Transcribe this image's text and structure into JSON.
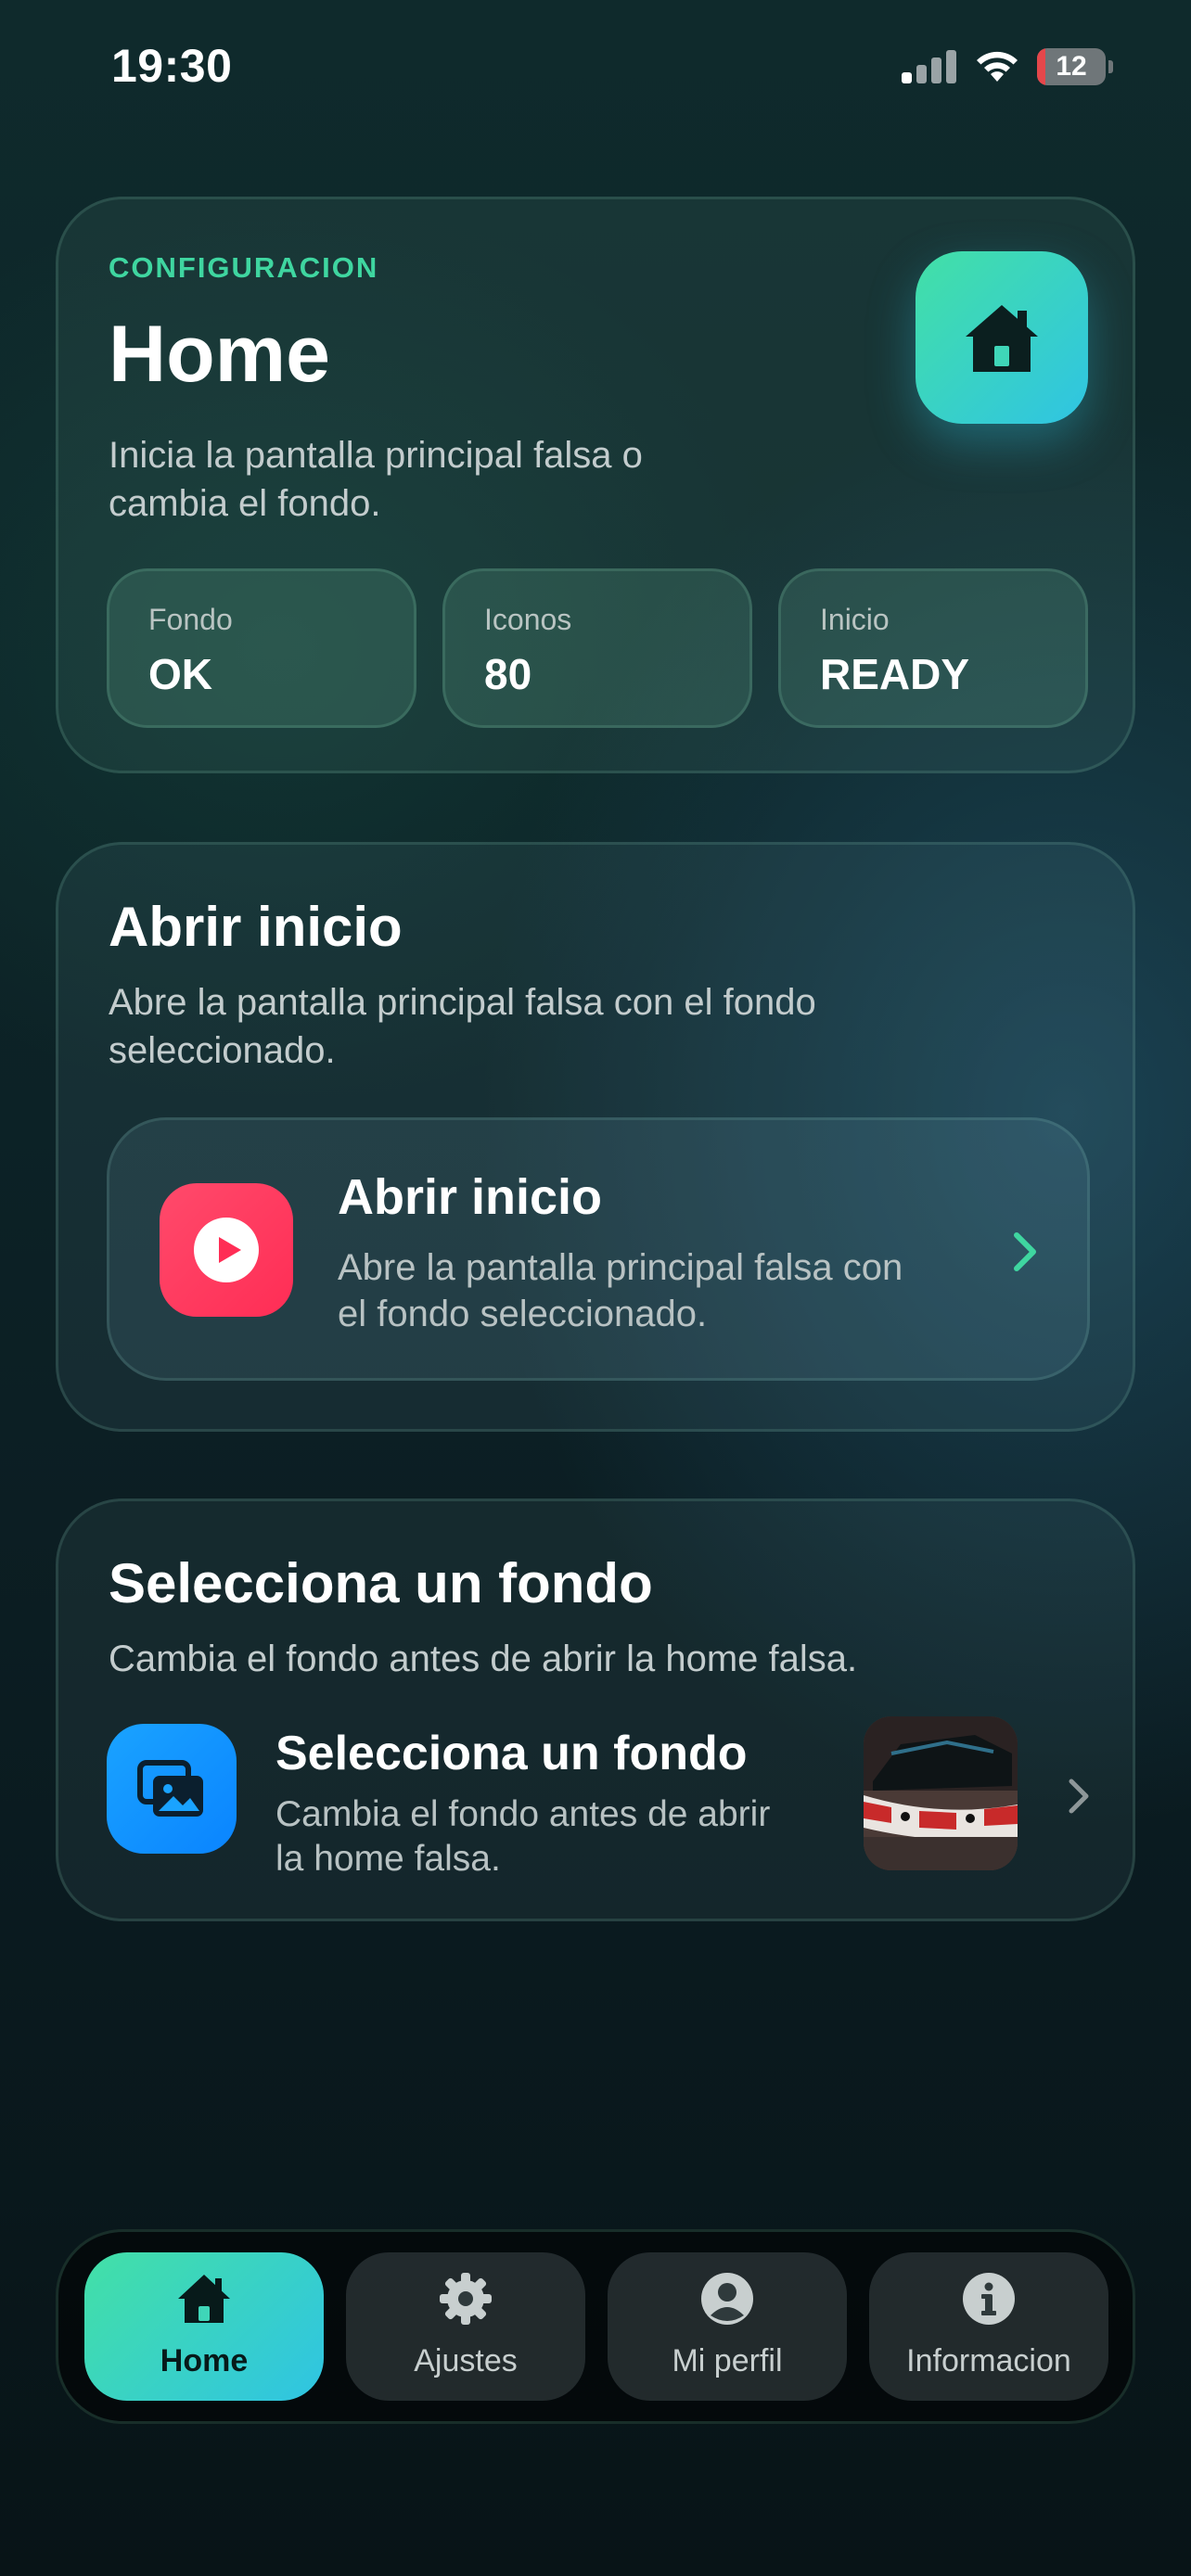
{
  "status_bar": {
    "time": "19:30",
    "battery": "12",
    "battery_level": 0.12
  },
  "hero": {
    "eyebrow": "CONFIGURACION",
    "title": "Home",
    "description": "Inicia la pantalla principal falsa o cambia el fondo.",
    "icon": "house-icon",
    "stats": [
      {
        "label": "Fondo",
        "value": "OK"
      },
      {
        "label": "Iconos",
        "value": "80"
      },
      {
        "label": "Inicio",
        "value": "READY"
      }
    ]
  },
  "open_section": {
    "title": "Abrir inicio",
    "description": "Abre la pantalla principal falsa con el fondo seleccionado.",
    "row": {
      "icon": "play-icon",
      "title": "Abrir inicio",
      "description": "Abre la pantalla principal falsa con el fondo seleccionado."
    }
  },
  "wallpaper_section": {
    "title": "Selecciona un fondo",
    "description": "Cambia el fondo antes de abrir la home falsa.",
    "row": {
      "icon": "images-icon",
      "title": "Selecciona un fondo",
      "description": "Cambia el fondo antes de abrir la home falsa."
    }
  },
  "tabbar": {
    "items": [
      {
        "label": "Home",
        "icon": "house-icon",
        "active": true
      },
      {
        "label": "Ajustes",
        "icon": "gear-icon",
        "active": false
      },
      {
        "label": "Mi perfil",
        "icon": "user-circle-icon",
        "active": false
      },
      {
        "label": "Informacion",
        "icon": "info-icon",
        "active": false
      }
    ]
  },
  "colors": {
    "accent_green": "#3fd6a0",
    "accent_cyan": "#2fc4e3",
    "play_red": "#ff2d55",
    "wallpaper_blue": "#0a84ff"
  }
}
